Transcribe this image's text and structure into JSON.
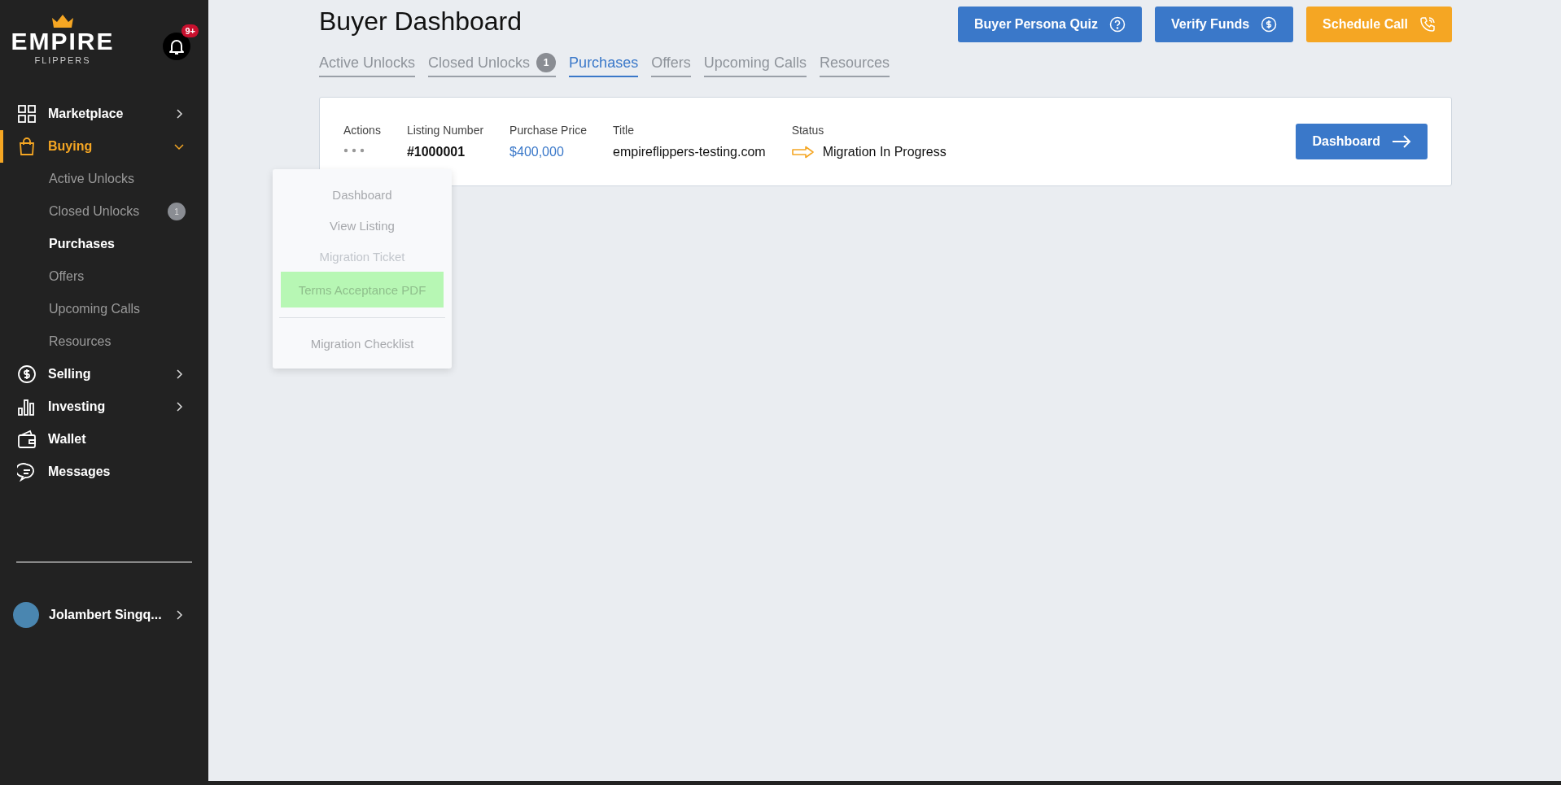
{
  "logo": {
    "word": "EMPIRE",
    "sub": "FLIPPERS"
  },
  "notifications": {
    "badge": "9+"
  },
  "nav": [
    {
      "label": "Marketplace",
      "kind": "menu",
      "active": false,
      "expanded": false
    },
    {
      "label": "Buying",
      "kind": "menu",
      "active": true,
      "expanded": true,
      "children": [
        {
          "label": "Active Unlocks",
          "selected": false
        },
        {
          "label": "Closed Unlocks",
          "selected": false,
          "badge": "1"
        },
        {
          "label": "Purchases",
          "selected": true
        },
        {
          "label": "Offers",
          "selected": false
        },
        {
          "label": "Upcoming Calls",
          "selected": false
        },
        {
          "label": "Resources",
          "selected": false
        }
      ]
    },
    {
      "label": "Selling",
      "kind": "menu",
      "active": false,
      "expanded": false
    },
    {
      "label": "Investing",
      "kind": "menu",
      "active": false,
      "expanded": false
    },
    {
      "label": "Wallet",
      "kind": "link",
      "active": false
    },
    {
      "label": "Messages",
      "kind": "link",
      "active": false
    }
  ],
  "user": {
    "name": "Jolambert Singq..."
  },
  "page": {
    "title": "Buyer Dashboard"
  },
  "header_buttons": [
    {
      "label": "Buyer Persona Quiz",
      "kind": "primary"
    },
    {
      "label": "Verify Funds",
      "kind": "primary"
    },
    {
      "label": "Schedule Call",
      "kind": "accent"
    }
  ],
  "tabs": [
    {
      "label": "Active Unlocks",
      "selected": false
    },
    {
      "label": "Closed Unlocks",
      "selected": false,
      "badge": "1"
    },
    {
      "label": "Purchases",
      "selected": true
    },
    {
      "label": "Offers",
      "selected": false
    },
    {
      "label": "Upcoming Calls",
      "selected": false
    },
    {
      "label": "Resources",
      "selected": false
    }
  ],
  "purchase": {
    "fields": [
      {
        "label": "Actions",
        "kind": "menu"
      },
      {
        "label": "Listing Number",
        "kind": "bold",
        "value": "#1000001"
      },
      {
        "label": "Purchase Price",
        "kind": "price",
        "value": "$400,000"
      },
      {
        "label": "Title",
        "kind": "plain",
        "value": "empireflippers-testing.com"
      },
      {
        "label": "Status",
        "kind": "status",
        "value": "Migration In Progress"
      }
    ],
    "button": "Dashboard"
  },
  "actions_menu": [
    {
      "label": "Dashboard",
      "kind": "item",
      "disabled": false,
      "selected": false
    },
    {
      "label": "View Listing",
      "kind": "item",
      "disabled": false,
      "selected": false
    },
    {
      "label": "Migration Ticket",
      "kind": "item",
      "disabled": true,
      "selected": false
    },
    {
      "label": "Terms Acceptance PDF",
      "kind": "item",
      "disabled": false,
      "selected": true
    },
    {
      "kind": "divider"
    },
    {
      "label": "Migration Checklist",
      "kind": "item",
      "disabled": false,
      "selected": false
    }
  ]
}
